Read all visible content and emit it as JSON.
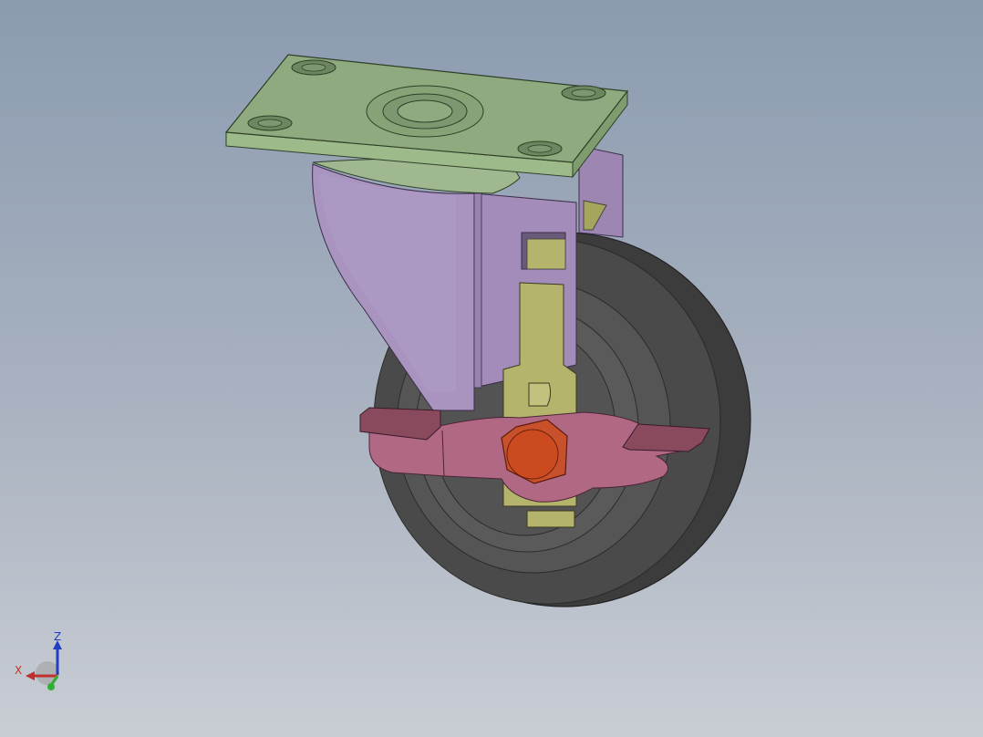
{
  "view": {
    "background_top": "#8b9bb0",
    "background_bottom": "#c9cdd4"
  },
  "model": {
    "parts": [
      {
        "name": "mounting-plate",
        "color": "#8faa7e"
      },
      {
        "name": "swivel-fork",
        "color": "#a894be"
      },
      {
        "name": "brake-lever",
        "color": "#b06884"
      },
      {
        "name": "brake-slider",
        "color": "#b4b46c"
      },
      {
        "name": "axle-nut",
        "color": "#c8502a"
      },
      {
        "name": "wheel-tire",
        "color": "#505050"
      }
    ]
  },
  "triad": {
    "x_label": "X",
    "z_label": "Z",
    "x_color": "#c03030",
    "y_color": "#30b030",
    "z_color": "#2040c0"
  }
}
